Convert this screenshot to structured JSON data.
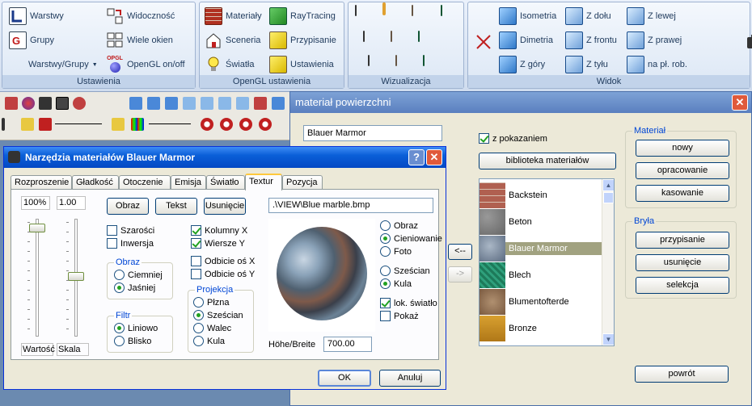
{
  "ribbon": {
    "groups": [
      {
        "label": "Ustawienia",
        "items": [
          "Warstwy",
          "Grupy",
          "Warstwy/Grupy",
          "Widoczność",
          "Wiele okien",
          "OpenGL on/off"
        ],
        "icon_text": "OPGL"
      },
      {
        "label": "OpenGL ustawienia",
        "items": [
          "Materiały",
          "Sceneria",
          "Światła",
          "RayTracing",
          "Przypisanie",
          "Ustawienia"
        ]
      },
      {
        "label": "Wizualizacja"
      },
      {
        "label": "Widok",
        "items": [
          "Isometria",
          "Dimetria",
          "Z góry",
          "Z dołu",
          "Z frontu",
          "Z tyłu",
          "Z lewej",
          "Z prawej",
          "na pł. rob."
        ]
      }
    ]
  },
  "mat_dialog": {
    "title": "materiał powierzchni",
    "name_value": "Blauer Marmor",
    "show_label": "z pokazaniem",
    "library_btn": "biblioteka materiałów",
    "arrow_left": "<--",
    "arrow_right": "->",
    "list": [
      "Backstein",
      "Beton",
      "Blauer Marmor",
      "Blech",
      "Blumentofterde",
      "Bronze"
    ],
    "material_group": {
      "label": "Materiał",
      "buttons": [
        "nowy",
        "opracowanie",
        "kasowanie"
      ]
    },
    "bryla_group": {
      "label": "Bryła",
      "buttons": [
        "przypisanie",
        "usunięcie",
        "selekcja"
      ]
    },
    "return_btn": "powrót",
    "colors": {
      "accent": "#0046d5",
      "selected": "#a1a280"
    }
  },
  "tools_dialog": {
    "title": "Narzędzia materiałów Blauer Marmor",
    "tabs": [
      "Rozproszenie",
      "Gładkość",
      "Otoczenie",
      "Emisja",
      "Światło",
      "Textur",
      "Pozycja"
    ],
    "active_tab": "Textur",
    "slider_values": [
      "100%",
      "1.00"
    ],
    "slider_captions": [
      "Wartość",
      "Skala"
    ],
    "buttons": [
      "Obraz",
      "Tekst",
      "Usunięcie"
    ],
    "path": ".\\VIEW\\Blue marble.bmp",
    "checkboxes_left": [
      {
        "label": "Szarości",
        "checked": false
      },
      {
        "label": "Inwersja",
        "checked": false
      }
    ],
    "checkboxes_mid": [
      {
        "label": "Kolumny X",
        "checked": true
      },
      {
        "label": "Wiersze Y",
        "checked": true
      },
      {
        "label": "Odbicie oś X",
        "checked": false
      },
      {
        "label": "Odbicie oś Y",
        "checked": false
      }
    ],
    "obraz_group": {
      "label": "Obraz",
      "options": [
        "Ciemniej",
        "Jaśniej"
      ],
      "selected": 1
    },
    "filtr_group": {
      "label": "Filtr",
      "options": [
        "Liniowo",
        "Blisko"
      ],
      "selected": 0
    },
    "projekcja_group": {
      "label": "Projekcja",
      "options": [
        "Płzna",
        "Sześcian",
        "Walec",
        "Kula"
      ],
      "selected": 1
    },
    "display_radios": {
      "options": [
        "Obraz",
        "Cieniowanie",
        "Foto"
      ],
      "selected": 1
    },
    "shape_radios": {
      "options": [
        "Sześcian",
        "Kula"
      ],
      "selected": 1
    },
    "extra_checks": [
      {
        "label": "lok. światło",
        "checked": true
      },
      {
        "label": "Pokaż",
        "checked": false
      }
    ],
    "ratio_label": "Höhe/Breite",
    "ratio_value": "700.00",
    "ok": "OK",
    "cancel": "Anuluj"
  }
}
